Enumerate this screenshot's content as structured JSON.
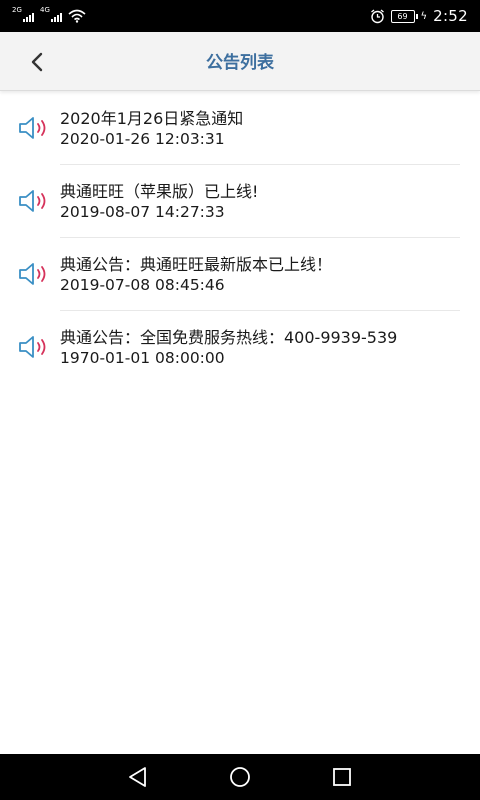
{
  "status_bar": {
    "network1": "2G",
    "network2": "4G",
    "battery": "69",
    "time": "2:52"
  },
  "header": {
    "title": "公告列表"
  },
  "notices": [
    {
      "title": "2020年1月26日紧急通知",
      "datetime": "2020-01-26 12:03:31"
    },
    {
      "title": "典通旺旺（苹果版）已上线!",
      "datetime": "2019-08-07 14:27:33"
    },
    {
      "title": "典通公告：典通旺旺最新版本已上线！",
      "datetime": "2019-07-08 08:45:46"
    },
    {
      "title": "典通公告：全国免费服务热线：400-9939-539",
      "datetime": "1970-01-01 08:00:00"
    }
  ],
  "icons": {
    "back": "chevron-left-icon",
    "notice": "speaker-icon",
    "nav_back": "triangle-back-icon",
    "nav_home": "circle-home-icon",
    "nav_recent": "square-recent-icon"
  },
  "colors": {
    "title": "#3d6f9f",
    "speaker_body": "#3a8fc4",
    "speaker_waves": "#d6335b",
    "status_bar": "#000000",
    "header_bg": "#f3f3f3"
  }
}
